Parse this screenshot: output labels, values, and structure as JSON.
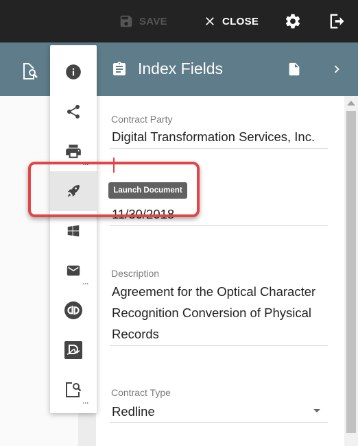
{
  "toolbar": {
    "save_label": "SAVE",
    "close_label": "CLOSE",
    "icons": {
      "save": "floppy-icon",
      "close": "close-icon",
      "settings": "gear-icon",
      "exit": "exit-icon"
    }
  },
  "subheader": {
    "title": "Index Fields",
    "bg_color": "#5f7c8a"
  },
  "side_menu": {
    "items": [
      {
        "name": "info-icon"
      },
      {
        "name": "share-icon"
      },
      {
        "name": "print-icon",
        "has_more": true
      },
      {
        "name": "rocket-icon",
        "active": true
      },
      {
        "name": "windows-icon"
      },
      {
        "name": "email-icon",
        "has_more": true
      },
      {
        "name": "quickbooks-icon"
      },
      {
        "name": "docusign-icon"
      },
      {
        "name": "document-search-icon",
        "has_more": true
      }
    ],
    "more_glyph": "..."
  },
  "tooltip": {
    "text": "Launch Document"
  },
  "fields": {
    "contract_party": {
      "label": "Contract Party",
      "value": "Digital Transformation Services, Inc."
    },
    "date": {
      "value": "11/30/2018"
    },
    "description": {
      "label": "Description",
      "lines": [
        "Agreement for the Optical Character",
        "Recognition Conversion of Physical",
        "Records"
      ]
    },
    "contract_type": {
      "label": "Contract Type",
      "value": "Redline"
    }
  },
  "colors": {
    "highlight": "#e34545",
    "topbar": "#232323"
  }
}
